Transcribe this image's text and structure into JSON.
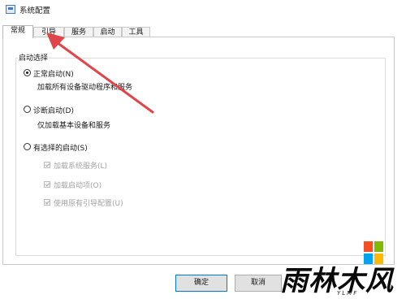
{
  "window": {
    "title": "系统配置"
  },
  "tabs": [
    {
      "label": "常规",
      "active": true
    },
    {
      "label": "引导",
      "active": false
    },
    {
      "label": "服务",
      "active": false
    },
    {
      "label": "启动",
      "active": false
    },
    {
      "label": "工具",
      "active": false
    }
  ],
  "startup_selection": {
    "label": "启动选择",
    "options": [
      {
        "label": "正常启动(N)",
        "description": "加载所有设备驱动程序和服务",
        "selected": true
      },
      {
        "label": "诊断启动(D)",
        "description": "仅加载基本设备和服务",
        "selected": false
      },
      {
        "label": "有选择的启动(S)",
        "selected": false
      }
    ],
    "selective_items": [
      {
        "label": "加载系统服务(L)",
        "checked": true,
        "enabled": false
      },
      {
        "label": "加载启动项(O)",
        "checked": true,
        "enabled": false
      },
      {
        "label": "使用原有引导配置(U)",
        "checked": true,
        "enabled": false
      }
    ]
  },
  "buttons": {
    "ok": "确定",
    "cancel": "取消"
  },
  "watermark": {
    "text": "雨林木风",
    "sub": "YLMF"
  },
  "colors": {
    "arrow": "#e0454a",
    "default_button_border": "#0078d7"
  }
}
